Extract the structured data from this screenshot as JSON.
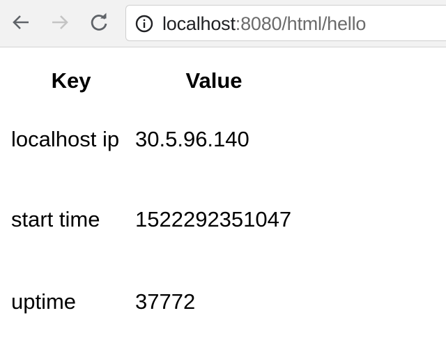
{
  "browser": {
    "url_host": "localhost",
    "url_rest": ":8080/html/hello",
    "icons": {
      "back": "arrow-left-icon",
      "forward": "arrow-right-icon",
      "reload": "reload-icon",
      "site_info": "info-icon"
    }
  },
  "table": {
    "headers": {
      "key": "Key",
      "value": "Value"
    },
    "rows": [
      {
        "key": "localhost ip",
        "value": "30.5.96.140"
      },
      {
        "key": "start time",
        "value": "1522292351047"
      },
      {
        "key": "uptime",
        "value": "37772"
      }
    ]
  }
}
